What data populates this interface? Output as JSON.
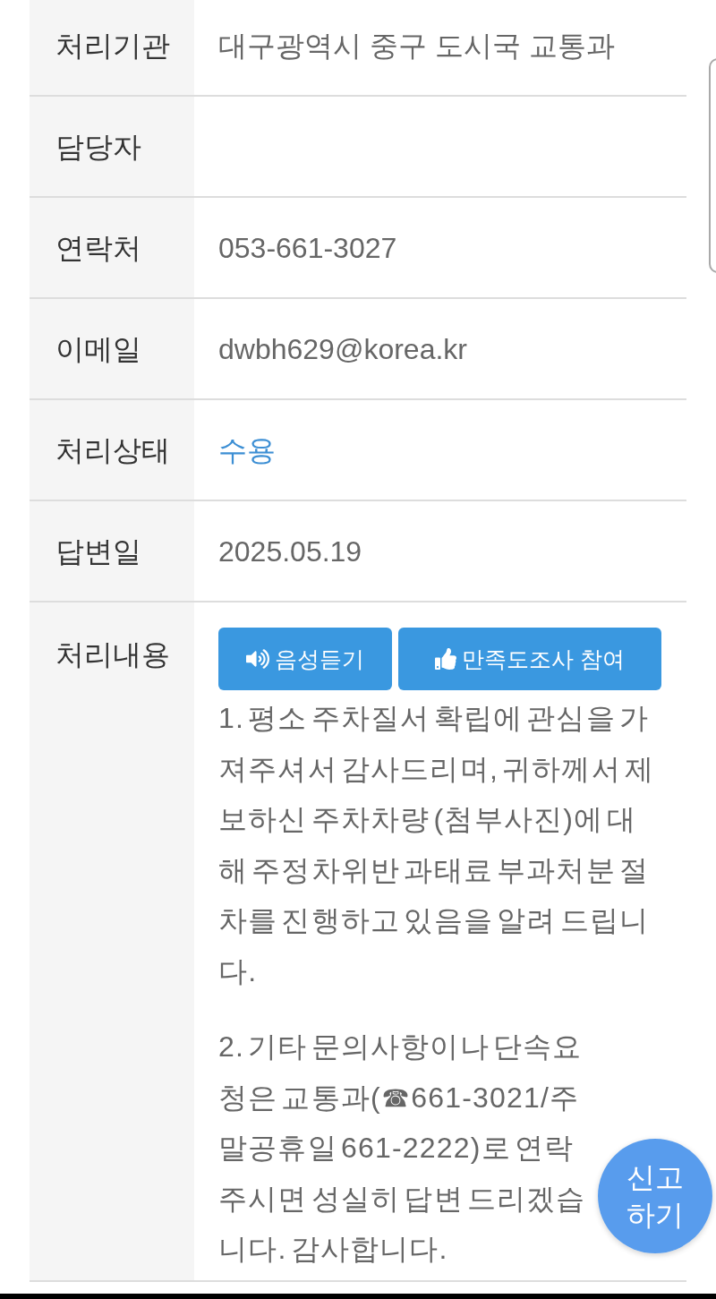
{
  "rows": [
    {
      "kind": "text",
      "label": "처리기관",
      "value": "대구광역시 중구 도시국 교통과"
    },
    {
      "kind": "text",
      "label": "담당자"
    },
    {
      "kind": "text",
      "label": "연락처",
      "value": "053-661-3027"
    },
    {
      "kind": "text",
      "label": "이메일",
      "value": "dwbh629@korea.kr"
    },
    {
      "kind": "status",
      "label": "처리상태",
      "value": "수용"
    },
    {
      "kind": "text",
      "label": "답변일",
      "value": "2025.05.19"
    },
    {
      "kind": "content",
      "label": "처리내용",
      "buttons": [
        {
          "kind": "audio",
          "label": "음성듣기"
        },
        {
          "kind": "survey",
          "label": "만족도조사 참여"
        }
      ],
      "paragraphs": [
        "1. 평소 주차질서 확립에 관심을 가져주셔서 감사드리며, 귀하께서 제보하신 주차차량 (첨부사진)에 대해 주정차위반 과태료 부과처분 절차를 진행하고 있음을 알려 드립니다.",
        "2. 기타 문의사항이나 단속요청은 교통과(☎661-3021/주말공휴일 661-2222)로 연락주시면 성실히 답변 드리겠습니다. 감사합니다."
      ]
    }
  ],
  "floating_button": {
    "label": "신고하기"
  }
}
